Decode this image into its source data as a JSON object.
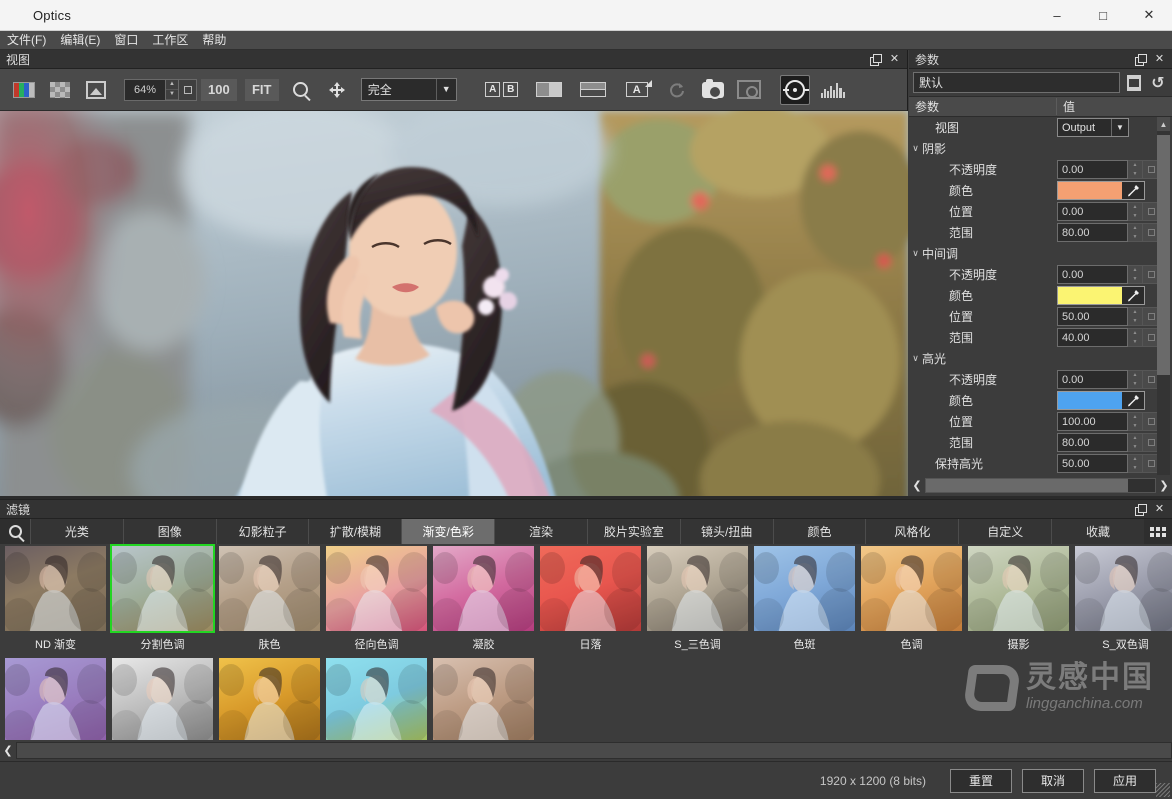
{
  "window": {
    "title": "Optics",
    "app_icon": "cube-icon",
    "minimize": "–",
    "maximize": "□",
    "close": "✕"
  },
  "menu": {
    "items": [
      {
        "label": "文件(F)",
        "name": "menu-file"
      },
      {
        "label": "编辑(E)",
        "name": "menu-edit"
      },
      {
        "label": "窗口",
        "name": "menu-window"
      },
      {
        "label": "工作区",
        "name": "menu-workspace"
      },
      {
        "label": "帮助",
        "name": "menu-help"
      }
    ]
  },
  "viewer": {
    "panel_title": "视图",
    "zoom_value": "64%",
    "btn_100": "100",
    "btn_fit": "FIT",
    "fit_mode": "完全",
    "ab_a": "A",
    "ab_b": "B",
    "a_label": "A",
    "icons": [
      "rgb-channels-icon",
      "checkerboard-icon",
      "image-icon",
      "magnifier-icon",
      "pan-icon",
      "ab-compare-icon",
      "split-vertical-icon",
      "split-horizontal-icon",
      "text-overlay-icon",
      "refresh-icon",
      "camera-icon",
      "screenshot-icon",
      "target-icon",
      "histogram-icon"
    ]
  },
  "params": {
    "panel_title": "参数",
    "preset_value": "默认",
    "col_name": "参数",
    "col_value": "值",
    "rows": [
      {
        "label": "视图",
        "type": "select",
        "value": "Output",
        "indent": 1,
        "twisty": ""
      },
      {
        "label": "阴影",
        "type": "group",
        "value": "",
        "indent": 0,
        "twisty": "∨"
      },
      {
        "label": "不透明度",
        "type": "number",
        "value": "0.00",
        "indent": 2,
        "twisty": ""
      },
      {
        "label": "颜色",
        "type": "color",
        "value": "#f4a072",
        "indent": 2,
        "twisty": ""
      },
      {
        "label": "位置",
        "type": "number",
        "value": "0.00",
        "indent": 2,
        "twisty": ""
      },
      {
        "label": "范围",
        "type": "number",
        "value": "80.00",
        "indent": 2,
        "twisty": ""
      },
      {
        "label": "中间调",
        "type": "group",
        "value": "",
        "indent": 0,
        "twisty": "∨"
      },
      {
        "label": "不透明度",
        "type": "number",
        "value": "0.00",
        "indent": 2,
        "twisty": ""
      },
      {
        "label": "颜色",
        "type": "color",
        "value": "#fbf472",
        "indent": 2,
        "twisty": ""
      },
      {
        "label": "位置",
        "type": "number",
        "value": "50.00",
        "indent": 2,
        "twisty": ""
      },
      {
        "label": "范围",
        "type": "number",
        "value": "40.00",
        "indent": 2,
        "twisty": ""
      },
      {
        "label": "高光",
        "type": "group",
        "value": "",
        "indent": 0,
        "twisty": "∨"
      },
      {
        "label": "不透明度",
        "type": "number",
        "value": "0.00",
        "indent": 2,
        "twisty": ""
      },
      {
        "label": "颜色",
        "type": "color",
        "value": "#4ea3f0",
        "indent": 2,
        "twisty": ""
      },
      {
        "label": "位置",
        "type": "number",
        "value": "100.00",
        "indent": 2,
        "twisty": ""
      },
      {
        "label": "范围",
        "type": "number",
        "value": "80.00",
        "indent": 2,
        "twisty": ""
      },
      {
        "label": "保持高光",
        "type": "number",
        "value": "50.00",
        "indent": 1,
        "twisty": ""
      }
    ]
  },
  "filters": {
    "panel_title": "滤镜",
    "search_icon": "search-icon",
    "grid_icon": "grid-view-icon",
    "tabs": [
      {
        "label": "光类",
        "active": false
      },
      {
        "label": "图像",
        "active": false
      },
      {
        "label": "幻影粒子",
        "active": false
      },
      {
        "label": "扩散/模糊",
        "active": false
      },
      {
        "label": "渐变/色彩",
        "active": true
      },
      {
        "label": "渲染",
        "active": false
      },
      {
        "label": "胶片实验室",
        "active": false
      },
      {
        "label": "镜头/扭曲",
        "active": false
      },
      {
        "label": "颜色",
        "active": false
      },
      {
        "label": "风格化",
        "active": false
      },
      {
        "label": "自定义",
        "active": false
      },
      {
        "label": "收藏",
        "active": false
      }
    ],
    "row1": [
      {
        "label": "ND 渐变",
        "selected": false,
        "tint": "linear-gradient(160deg,#6b5e62 0%,#8c7a62 45%,#7a6b55 100%)"
      },
      {
        "label": "分割色调",
        "selected": true,
        "tint": "linear-gradient(160deg,#b9c6cc 0%,#9fae9a 50%,#9b8a5e 100%)"
      },
      {
        "label": "肤色",
        "selected": false,
        "tint": "linear-gradient(160deg,#cfc2b4 0%,#b5a089 50%,#9e8a6d 100%)"
      },
      {
        "label": "径向色调",
        "selected": false,
        "tint": "linear-gradient(160deg,#f0d08a 0%,#e8a0a0 55%,#d4547a 100%)"
      },
      {
        "label": "凝胶",
        "selected": false,
        "tint": "linear-gradient(160deg,#e3a9c8 0%,#d36ba0 50%,#b43d7e 100%)"
      },
      {
        "label": "日落",
        "selected": false,
        "tint": "linear-gradient(160deg,#f06a5a 0%,#e8564e 50%,#b33a38 100%)"
      },
      {
        "label": "S_三色调",
        "selected": false,
        "tint": "linear-gradient(160deg,#d8cdbc 0%,#b0a694 50%,#7d7468 100%)"
      },
      {
        "label": "色斑",
        "selected": false,
        "tint": "linear-gradient(160deg,#9fc4e8 0%,#7fa8d8 50%,#5c84b8 100%)"
      },
      {
        "label": "色调",
        "selected": false,
        "tint": "linear-gradient(160deg,#f2c98a 0%,#e2a45c 50%,#c27c3a 100%)"
      },
      {
        "label": "摄影",
        "selected": false,
        "tint": "linear-gradient(160deg,#cfd6c2 0%,#b0bb9a 50%,#8e9a74 100%)"
      },
      {
        "label": "S_双色调",
        "selected": false,
        "tint": "linear-gradient(160deg,#c9cbd6 0%,#9c9ead 50%,#6f7280 100%)"
      }
    ],
    "row2": [
      {
        "label": "",
        "selected": false,
        "tint": "linear-gradient(160deg,#a89ad4 0%,#9a7fc0 50%,#8e5fa8 100%)"
      },
      {
        "label": "",
        "selected": false,
        "tint": "linear-gradient(160deg,#e8e8e8 0%,#bdbdbd 50%,#8a8a8a 100%)"
      },
      {
        "label": "",
        "selected": false,
        "tint": "linear-gradient(160deg,#f0c24a 0%,#d89a2a 50%,#a8701a 100%)"
      },
      {
        "label": "",
        "selected": false,
        "tint": "linear-gradient(160deg,#8fe0ee 0%,#7ecbe0 50%,#a8c25a 100%)"
      },
      {
        "label": "",
        "selected": false,
        "tint": "linear-gradient(160deg,#d8c0b0 0%,#bd9c84 50%,#9c7a5e 100%)"
      }
    ]
  },
  "watermark": {
    "cn": "灵感中国",
    "en": "lingganchina",
    "en_suffix": ".com"
  },
  "status": {
    "dimensions": "1920 x 1200  (8 bits)",
    "reset": "重置",
    "cancel": "取消",
    "apply": "应用"
  },
  "colors": {
    "accent_green": "#22d622",
    "panel_bg": "#3c3c3c",
    "toolbar_bg": "#4a4a4a",
    "tab_active": "#6d6d6d"
  }
}
